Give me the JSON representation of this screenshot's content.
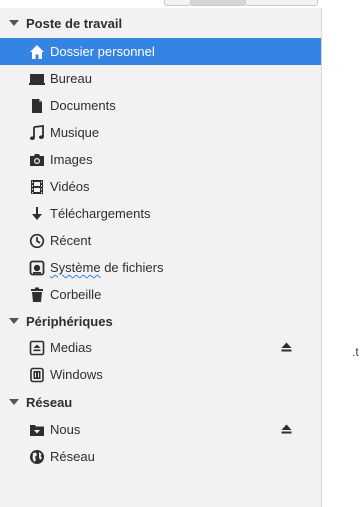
{
  "window": {
    "accent_color": "#3584e4",
    "sidebar_bg": "#f2f2f2"
  },
  "sidebar": {
    "sections": [
      {
        "title": "Poste de travail",
        "items": [
          {
            "label": "Dossier personnel",
            "icon": "home-icon",
            "selected": true
          },
          {
            "label": "Bureau",
            "icon": "desktop-icon"
          },
          {
            "label": "Documents",
            "icon": "document-icon"
          },
          {
            "label": "Musique",
            "icon": "music-icon"
          },
          {
            "label": "Images",
            "icon": "camera-icon"
          },
          {
            "label": "Vidéos",
            "icon": "film-icon"
          },
          {
            "label": "Téléchargements",
            "icon": "download-icon"
          },
          {
            "label": "Récent",
            "icon": "clock-icon"
          },
          {
            "label_part1": "Système",
            "label_part2": " de ",
            "label_part3": "fichiers",
            "icon": "drive-icon"
          },
          {
            "label": "Corbeille",
            "icon": "trash-icon"
          }
        ]
      },
      {
        "title": "Périphériques",
        "items": [
          {
            "label": "Medias",
            "icon": "removable-drive-icon",
            "eject": true
          },
          {
            "label": "Windows",
            "icon": "harddisk-icon"
          }
        ]
      },
      {
        "title": "Réseau",
        "items": [
          {
            "label": "Nous",
            "icon": "network-share-icon",
            "eject": true
          },
          {
            "label": "Réseau",
            "icon": "globe-icon"
          }
        ]
      }
    ]
  },
  "main": {
    "partial_text": ".t"
  }
}
